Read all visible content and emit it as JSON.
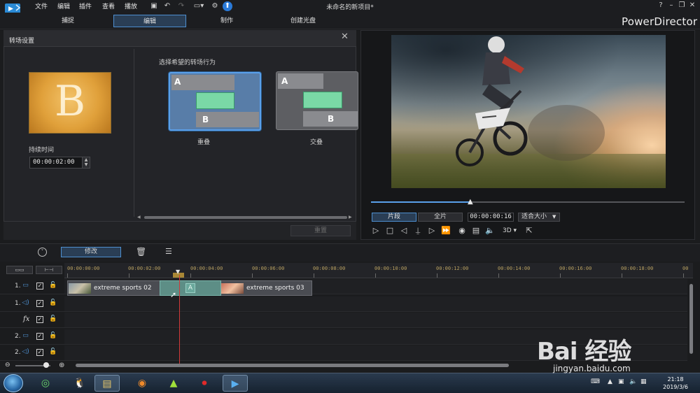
{
  "menu": {
    "items": [
      "文件",
      "编辑",
      "插件",
      "查看",
      "播放"
    ]
  },
  "window": {
    "title": "未命名的新项目*",
    "brand": "PowerDirector",
    "help": "?",
    "min": "–",
    "restore": "❐",
    "close": "✕"
  },
  "modes": {
    "tabs": [
      "捕捉",
      "编辑",
      "制作",
      "创建光盘"
    ],
    "active": "编辑"
  },
  "transition_panel": {
    "title": "转场设置",
    "preview_letter": "B",
    "duration_label": "持续时间",
    "duration_value": "00:00:02:00",
    "choose_label": "选择希望的转场行为",
    "options": [
      {
        "caption": "重叠",
        "selected": true,
        "a": "A",
        "b": "B"
      },
      {
        "caption": "交叠",
        "selected": false,
        "a": "A",
        "b": "B"
      }
    ],
    "reset_label": "重置"
  },
  "player": {
    "scrub_progress": 0.32,
    "segment_label": "片段",
    "movie_label": "全片",
    "timecode": "00:00:00:16",
    "fit_label": "适合大小",
    "threed_label": "3D"
  },
  "timeline": {
    "modify_label": "修改",
    "ruler_ticks": [
      "00:00:00:00",
      "00:00:02:00",
      "00:00:04:00",
      "00:00:06:00",
      "00:00:08:00",
      "00:00:10:00",
      "00:00:12:00",
      "00:00:14:00",
      "00:00:16:00",
      "00:00:18:00",
      "00"
    ],
    "tracks": [
      {
        "num": "1.",
        "type": "video"
      },
      {
        "num": "1.",
        "type": "audio"
      },
      {
        "num": "",
        "type": "fx",
        "label": "fx"
      },
      {
        "num": "2.",
        "type": "video"
      },
      {
        "num": "2.",
        "type": "audio"
      }
    ],
    "clips": [
      {
        "name": "extreme sports 02"
      },
      {
        "name": "extreme sports 03"
      }
    ],
    "transition_marker": "A"
  },
  "taskbar": {
    "time": "21:18",
    "date": "2019/3/6"
  },
  "watermark": {
    "logo": "Bai  经验",
    "url": "jingyan.baidu.com"
  },
  "colors": {
    "accent": "#4e8fd0",
    "playhead": "#d23a3a",
    "transition": "#7ad8a6"
  }
}
